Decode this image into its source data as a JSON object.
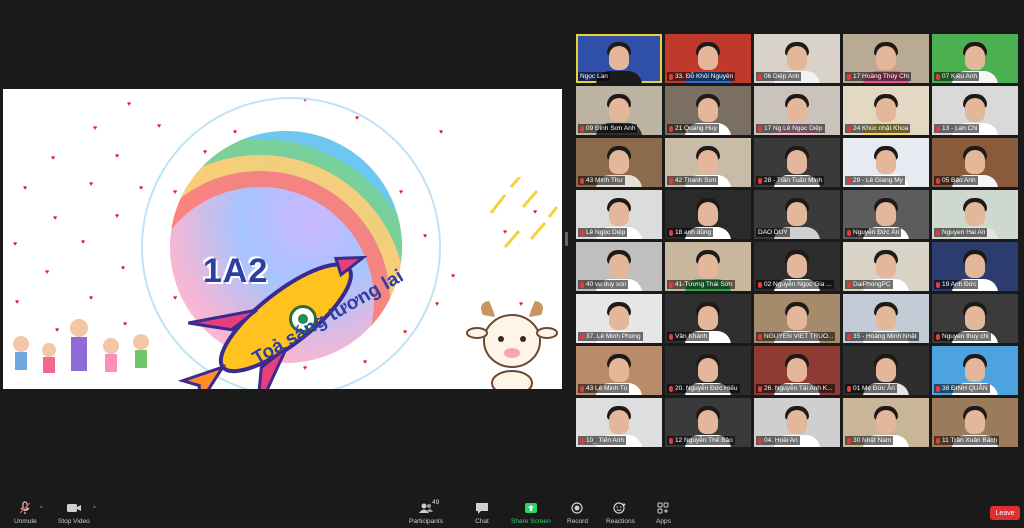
{
  "shared_screen": {
    "logo_text": "1A2",
    "motto": "Toả sáng tương lai"
  },
  "gallery": [
    {
      "name": "Ngọc Lan",
      "muted": false,
      "active": true,
      "bg": "#2f4fa8",
      "shirt": "#1b1b1b"
    },
    {
      "name": "33. Đỗ Khôi Nguyên",
      "muted": true,
      "bg": "#c0392b",
      "shirt": "#2e6fd1"
    },
    {
      "name": "06 Diệp Anh",
      "muted": true,
      "bg": "#d8d2c8",
      "shirt": "#f2f2f2"
    },
    {
      "name": "17 Hoàng Thùy Chi",
      "muted": true,
      "bg": "#b9aa94",
      "shirt": "#e35a8d"
    },
    {
      "name": "07 Kiều Anh",
      "muted": true,
      "bg": "#4caf50",
      "shirt": "#f5f5f5"
    },
    {
      "name": "09 Đinh Sơn Anh",
      "muted": true,
      "bg": "#bdb3a3",
      "shirt": "#2f2f2f"
    },
    {
      "name": "21 Quang Huy",
      "muted": true,
      "bg": "#7b6f63",
      "shirt": "#ffffff"
    },
    {
      "name": "17 Ng Lê Ngọc Diệp",
      "muted": true,
      "bg": "#c9c3bc",
      "shirt": "#f0b5c8"
    },
    {
      "name": "24 Khúc nhật Khoa",
      "muted": true,
      "bg": "#e3d8c4",
      "shirt": "#f2d65e"
    },
    {
      "name": "13 - Lan Chi",
      "muted": true,
      "bg": "#d9d9d9",
      "shirt": "#ffffff"
    },
    {
      "name": "43 Minh Thư",
      "muted": true,
      "bg": "#8b6a4d",
      "shirt": "#e7e1d5"
    },
    {
      "name": "42 Thanh Sơn",
      "muted": true,
      "bg": "#c8bba8",
      "shirt": "#ffffff"
    },
    {
      "name": "28 - Trần Tuấn Minh",
      "muted": true,
      "bg": "#3a3a3a",
      "shirt": "#ffffff"
    },
    {
      "name": "29 - Lê Giang My",
      "muted": true,
      "bg": "#e7eaf0",
      "shirt": "#ffffff"
    },
    {
      "name": "05 Bảo Anh",
      "muted": true,
      "bg": "#8a5a3c",
      "shirt": "#f5f5f5"
    },
    {
      "name": "Lê Ngọc Diệp",
      "muted": true,
      "bg": "#dcdcdc",
      "shirt": "#ffffff"
    },
    {
      "name": "18 anh dũng",
      "muted": true,
      "bg": "#2a2a2a",
      "shirt": "#ffffff"
    },
    {
      "name": "DAO DUY",
      "muted": false,
      "bg": "#3a3a3a",
      "shirt": "#cfcfcf"
    },
    {
      "name": "Nguyễn Đức Ân",
      "muted": true,
      "bg": "#5c5c5c",
      "shirt": "#ffffff"
    },
    {
      "name": "Nguyen Hai An",
      "muted": true,
      "bg": "#cfd8cf",
      "shirt": "#e3e3e3"
    },
    {
      "name": "40 vu duy son",
      "muted": true,
      "bg": "#bfbfbf",
      "shirt": "#ffffff"
    },
    {
      "name": "41-Tương Thái Sơn",
      "muted": true,
      "bg": "#c9b79d",
      "shirt": "#2fa34f"
    },
    {
      "name": "02 Nguyễn Ngọc Gia ...",
      "muted": true,
      "bg": "#2c2c2c",
      "shirt": "#ffffff"
    },
    {
      "name": "DaiPhongPC",
      "muted": true,
      "bg": "#d9d2c6",
      "shirt": "#ffffff"
    },
    {
      "name": "19 Anh Đức",
      "muted": true,
      "bg": "#2c3c6e",
      "shirt": "#ffffff"
    },
    {
      "name": "37. Lê Minh Phong",
      "muted": true,
      "bg": "#e6e6e6",
      "shirt": "#ffffff"
    },
    {
      "name": "Vân Khánh",
      "muted": true,
      "bg": "#2f2f2f",
      "shirt": "#ffffff"
    },
    {
      "name": "NGUYEN VIET TRUO...",
      "muted": true,
      "bg": "#a58a6c",
      "shirt": "#f0f0f0"
    },
    {
      "name": "35 - Hoàng Minh Nhật",
      "muted": true,
      "bg": "#c2cbd6",
      "shirt": "#ffffff"
    },
    {
      "name": "Nguyen thuy chi",
      "muted": true,
      "bg": "#3b3b3b",
      "shirt": "#ffffff"
    },
    {
      "name": "43 Lê Minh Tú",
      "muted": true,
      "bg": "#b88b6a",
      "shirt": "#ffffff"
    },
    {
      "name": "20. Nguyễn Đức Hiếu",
      "muted": true,
      "bg": "#2b2b2b",
      "shirt": "#ffffff"
    },
    {
      "name": "26. Nguyễn Tài Anh K...",
      "muted": true,
      "bg": "#8d3b33",
      "shirt": "#ffffff"
    },
    {
      "name": "01 Mẹ Đức Ân",
      "muted": true,
      "bg": "#2e2e2e",
      "shirt": "#e6e6e6"
    },
    {
      "name": "38 ĐINH QUÂN",
      "muted": true,
      "bg": "#4da3e0",
      "shirt": "#ffffff"
    },
    {
      "name": "10_ Tiến Anh",
      "muted": true,
      "bg": "#dedede",
      "shirt": "#ffffff"
    },
    {
      "name": "12 Nguyễn Thế Bảo",
      "muted": true,
      "bg": "#3a3a3a",
      "shirt": "#ffffff"
    },
    {
      "name": "04. Hoài An",
      "muted": true,
      "bg": "#cfcfcf",
      "shirt": "#ffffff"
    },
    {
      "name": "30 Nhật Nam",
      "muted": true,
      "bg": "#c9b698",
      "shirt": "#ffffff"
    },
    {
      "name": "11 Trần Xuân Bách",
      "muted": true,
      "bg": "#9c7b5c",
      "shirt": "#f3f3f3"
    }
  ],
  "toolbar": {
    "unmute": "Unmute",
    "stop_video": "Stop Video",
    "participants": "Participants",
    "participants_count": "49",
    "chat": "Chat",
    "share_screen": "Share Screen",
    "record": "Record",
    "reactions": "Reactions",
    "apps": "Apps",
    "leave": "Leave"
  },
  "colors": {
    "share_accent": "#2fd36a",
    "leave_bg": "#e02f2f",
    "active_tile_border": "#e8d23a",
    "muted_mic": "#e23b3b"
  }
}
